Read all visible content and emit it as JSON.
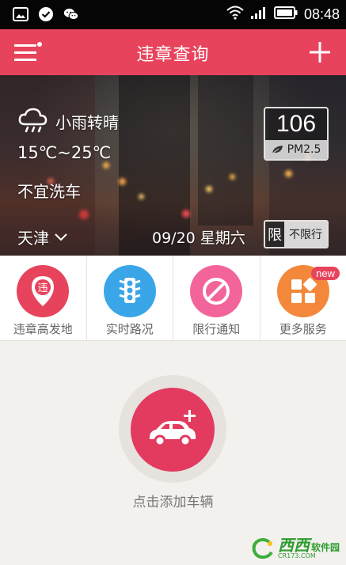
{
  "status_bar": {
    "time": "08:48",
    "icons_left": [
      "image-icon",
      "check-circle-icon",
      "wechat-icon"
    ],
    "icons_right": [
      "wifi-icon",
      "signal-icon",
      "battery-icon"
    ]
  },
  "app_bar": {
    "title": "违章查询",
    "left_icon": "menu-icon",
    "right_icon": "plus-icon"
  },
  "weather": {
    "condition": "小雨转晴",
    "temperature": "15℃~25℃",
    "car_wash": "不宜洗车",
    "city": "天津",
    "date": "09/20 星期六",
    "aqi_value": "106",
    "aqi_label": "PM2.5",
    "limit_tag": "限",
    "limit_text": "不限行"
  },
  "services": [
    {
      "label": "违章高发地",
      "icon": "violation-location-icon",
      "icon_text": "违",
      "color": "#e8435c"
    },
    {
      "label": "实时路况",
      "icon": "traffic-light-icon",
      "color": "#3aa6e8"
    },
    {
      "label": "限行通知",
      "icon": "no-entry-icon",
      "color": "#f2649a"
    },
    {
      "label": "更多服务",
      "icon": "grid-icon",
      "color": "#f3883a",
      "badge": "new"
    }
  ],
  "add_car": {
    "label": "点击添加车辆",
    "color": "#e33a60"
  },
  "watermark": {
    "main": "西西",
    "secondary": "软件园",
    "sub": "CR173.COM"
  }
}
